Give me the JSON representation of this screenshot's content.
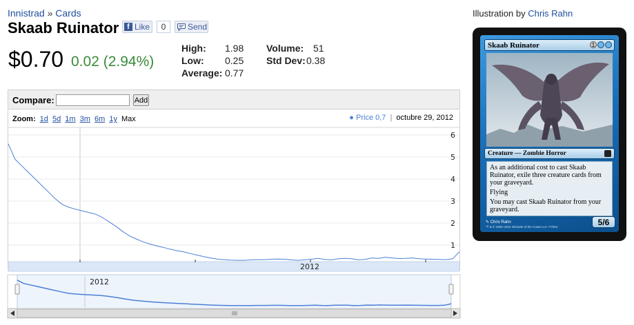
{
  "breadcrumb": {
    "set": "Innistrad",
    "sep": "»",
    "section": "Cards"
  },
  "card_name": "Skaab Ruinator",
  "social": {
    "like_label": "Like",
    "like_count": "0",
    "send_label": "Send"
  },
  "price": {
    "current": "$0.70",
    "change": "0.02 (2.94%)"
  },
  "stats": {
    "high_label": "High:",
    "high": "1.98",
    "low_label": "Low:",
    "low": "0.25",
    "avg_label": "Average:",
    "avg": "0.77",
    "volume_label": "Volume:",
    "volume": "51",
    "stddev_label": "Std Dev:",
    "stddev": "0.38"
  },
  "compare": {
    "label": "Compare:",
    "value": "",
    "add_label": "Add"
  },
  "zoom": {
    "label": "Zoom:",
    "options": [
      "1d",
      "5d",
      "1m",
      "3m",
      "6m",
      "1y"
    ],
    "active": "Max"
  },
  "legend": {
    "bullet": "●",
    "series_label": "Price 0,7",
    "sep": "|",
    "date": "octubre 29, 2012"
  },
  "chart_data": {
    "type": "line",
    "series": [
      {
        "name": "Price",
        "values": [
          5.6,
          4.9,
          4.6,
          4.3,
          4.0,
          3.7,
          3.4,
          3.1,
          2.85,
          2.72,
          2.63,
          2.55,
          2.48,
          2.4,
          2.25,
          2.05,
          1.85,
          1.62,
          1.42,
          1.28,
          1.15,
          1.05,
          0.97,
          0.9,
          0.82,
          0.75,
          0.7,
          0.62,
          0.55,
          0.48,
          0.42,
          0.37,
          0.34,
          0.32,
          0.31,
          0.31,
          0.33,
          0.34,
          0.34,
          0.36,
          0.37,
          0.36,
          0.33,
          0.31,
          0.33,
          0.36,
          0.4,
          0.35,
          0.33,
          0.38,
          0.4,
          0.38,
          0.33,
          0.35,
          0.42,
          0.4,
          0.45,
          0.42,
          0.39,
          0.4,
          0.42,
          0.38,
          0.37,
          0.36,
          0.35,
          0.34,
          0.38,
          0.7
        ]
      }
    ],
    "y_ticks": [
      "6",
      "5",
      "4",
      "3",
      "2",
      "1"
    ],
    "ylim": [
      0,
      6
    ],
    "x_tick_label": "2012",
    "navigator_label": "2012",
    "grid": true
  },
  "illustration": {
    "prefix": "Illustration by",
    "artist": "Chris Rahn"
  },
  "card": {
    "name": "Skaab Ruinator",
    "mana_cost": "1UU",
    "mana_generic": "1",
    "type_line": "Creature — Zombie Horror",
    "rules": [
      "As an additional cost to cast Skaab Ruinator, exile three creature cards from your graveyard.",
      "Flying",
      "You may cast Skaab Ruinator from your graveyard."
    ],
    "pt": "5/6",
    "artist_credit": "Chris Rahn",
    "copyright": "™ & © 1993–2011 Wizards of the Coast LLC 77/264",
    "colors": {
      "frame": "#1a6fb8",
      "frame_dark": "#0b4f8c"
    }
  }
}
